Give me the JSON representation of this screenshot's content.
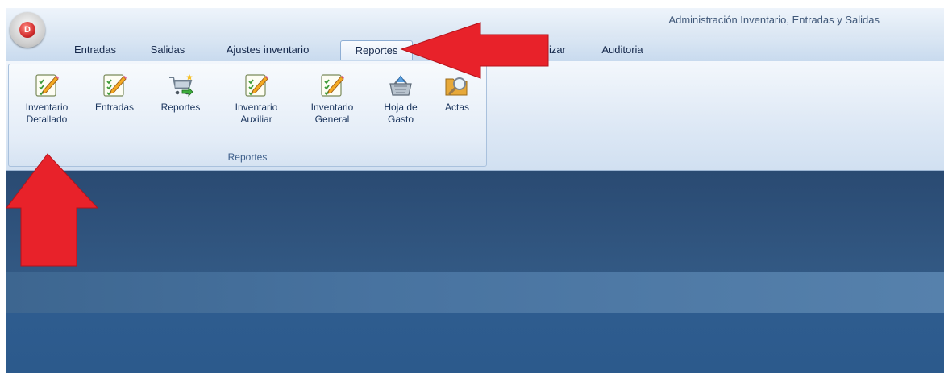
{
  "window": {
    "title": "Administración Inventario, Entradas y Salidas"
  },
  "office_button": {
    "glyph": "D"
  },
  "tabs": [
    {
      "label": "Entradas"
    },
    {
      "label": "Salidas"
    },
    {
      "label": "Ajustes inventario"
    },
    {
      "label": "Reportes"
    },
    {
      "label": "lizar"
    },
    {
      "label": "Auditoria"
    }
  ],
  "ribbon": {
    "group_label": "Reportes",
    "buttons": [
      {
        "line1": "Inventario",
        "line2": "Detallado",
        "icon": "checklist-pencil-icon"
      },
      {
        "line1": "Entradas",
        "line2": "",
        "icon": "checklist-pencil-icon"
      },
      {
        "line1": "Reportes",
        "line2": "",
        "icon": "cart-arrow-icon"
      },
      {
        "line1": "Inventario",
        "line2": "Auxiliar",
        "icon": "checklist-pencil-icon"
      },
      {
        "line1": "Inventario",
        "line2": "General",
        "icon": "checklist-pencil-icon"
      },
      {
        "line1": "Hoja de",
        "line2": "Gasto",
        "icon": "basket-icon"
      },
      {
        "line1": "Actas",
        "line2": "",
        "icon": "folder-magnifier-icon"
      }
    ]
  },
  "colors": {
    "annotation_arrow": "#e8222a",
    "workspace": "#2f5f8f",
    "ribbon_border": "#a9c1dd"
  }
}
